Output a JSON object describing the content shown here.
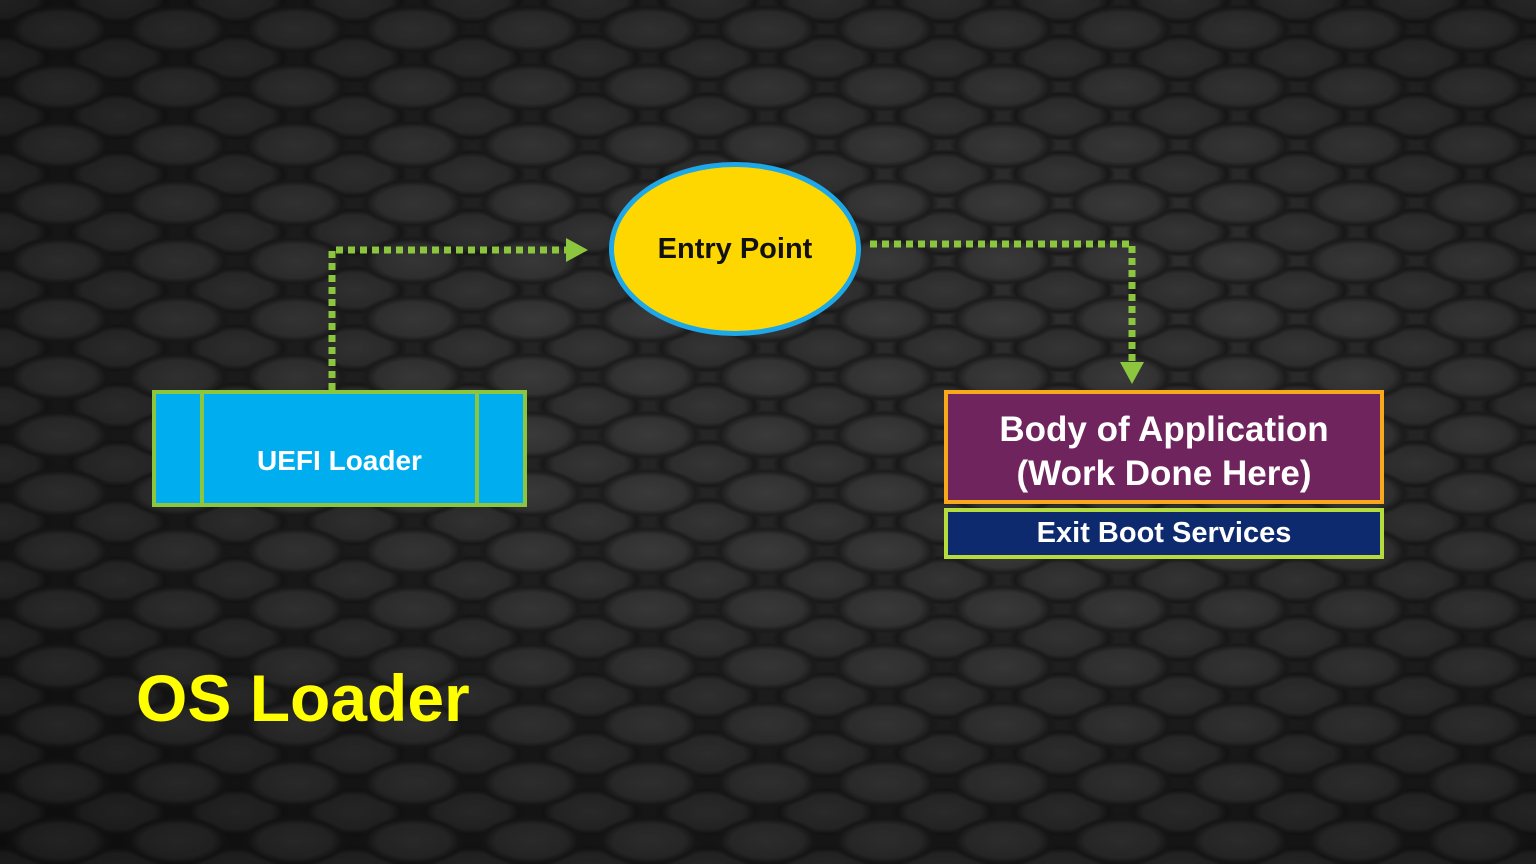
{
  "title": "OS Loader",
  "nodes": {
    "uefi_loader": "UEFI Loader",
    "entry_point": "Entry Point",
    "body_line1": "Body of Application",
    "body_line2": "(Work Done Here)",
    "exit_boot": "Exit Boot Services"
  },
  "colors": {
    "connector": "#8cc63f",
    "title": "#ffff00",
    "entry_fill": "#ffd700",
    "entry_border": "#1ea8e8",
    "uefi_fill": "#00adef",
    "body_fill": "#70245e",
    "body_border": "#f7a81b",
    "exit_fill": "#0d2a6e"
  }
}
